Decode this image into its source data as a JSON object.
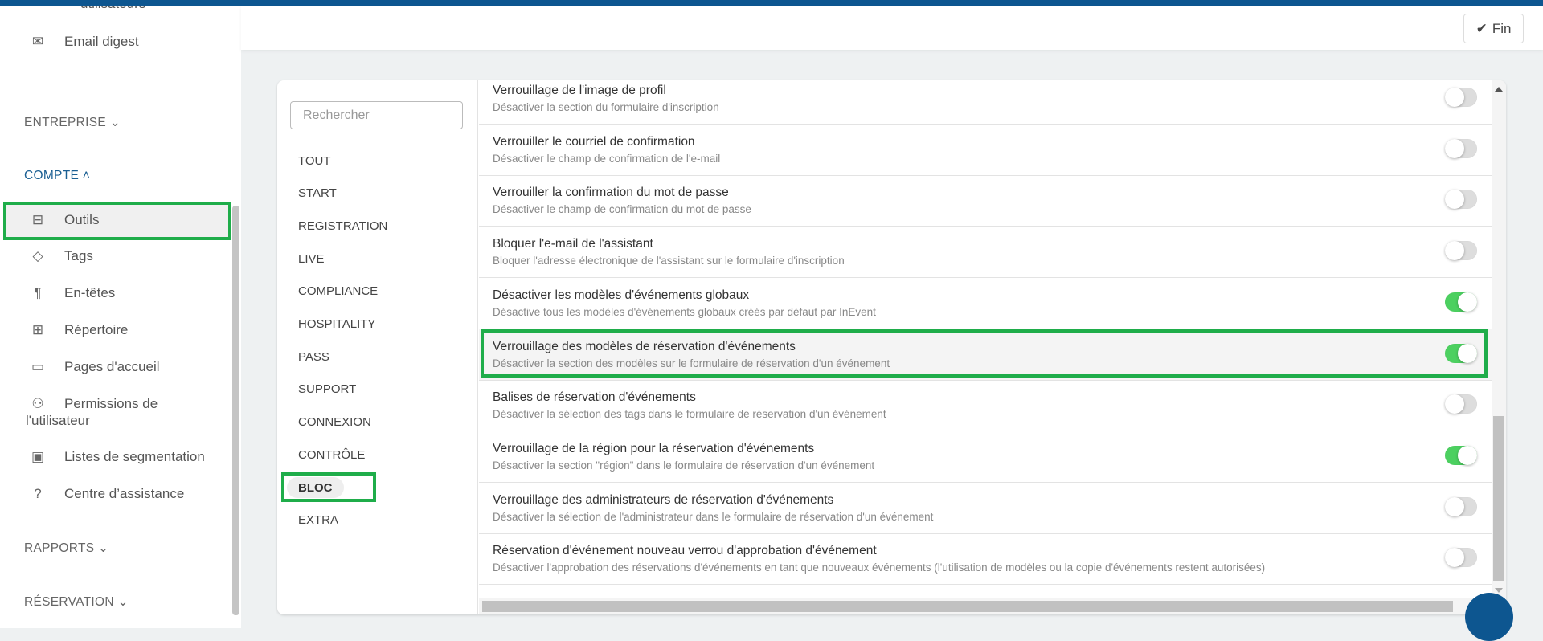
{
  "header": {
    "done_label": "Fin"
  },
  "sidebar": {
    "clipped_item": "utilisateurs",
    "email_digest": "Email digest",
    "sections": {
      "entreprise": "ENTREPRISE",
      "compte": "COMPTE",
      "rapports": "RAPPORTS",
      "reservation": "RÉSERVATION"
    },
    "items": [
      {
        "label": "Outils",
        "icon": "toolbox-icon",
        "selected": true
      },
      {
        "label": "Tags",
        "icon": "tag-icon"
      },
      {
        "label": "En-têtes",
        "icon": "pilcrow-icon"
      },
      {
        "label": "Répertoire",
        "icon": "sitemap-icon"
      },
      {
        "label": "Pages d'accueil",
        "icon": "window-icon"
      },
      {
        "label": "Permissions de",
        "label2": "l'utilisateur",
        "icon": "users-lock-icon"
      },
      {
        "label": "Listes de segmentation",
        "icon": "contact-book-icon"
      },
      {
        "label": "Centre d’assistance",
        "icon": "help-circle-icon"
      }
    ]
  },
  "filters": {
    "search_placeholder": "Rechercher",
    "items": [
      "TOUT",
      "START",
      "REGISTRATION",
      "LIVE",
      "COMPLIANCE",
      "HOSPITALITY",
      "PASS",
      "SUPPORT",
      "CONNEXION",
      "CONTRÔLE",
      "BLOC",
      "EXTRA"
    ],
    "selected": "BLOC"
  },
  "settings": [
    {
      "title": "Verrouillage de l'image de profil",
      "desc": "Désactiver la section du formulaire d'inscription",
      "on": false
    },
    {
      "title": "Verrouiller le courriel de confirmation",
      "desc": "Désactiver le champ de confirmation de l'e-mail",
      "on": false
    },
    {
      "title": "Verrouiller la confirmation du mot de passe",
      "desc": "Désactiver le champ de confirmation du mot de passe",
      "on": false
    },
    {
      "title": "Bloquer l'e-mail de l'assistant",
      "desc": "Bloquer l'adresse électronique de l'assistant sur le formulaire d'inscription",
      "on": false
    },
    {
      "title": "Désactiver les modèles d'événements globaux",
      "desc": "Désactive tous les modèles d'événements globaux créés par défaut par InEvent",
      "on": true
    },
    {
      "title": "Verrouillage des modèles de réservation d'événements",
      "desc": "Désactiver la section des modèles sur le formulaire de réservation d'un événement",
      "on": true,
      "highlighted": true
    },
    {
      "title": "Balises de réservation d'événements",
      "desc": "Désactiver la sélection des tags dans le formulaire de réservation d'un événement",
      "on": false
    },
    {
      "title": "Verrouillage de la région pour la réservation d'événements",
      "desc": "Désactiver la section \"région\" dans le formulaire de réservation d'un événement",
      "on": true
    },
    {
      "title": "Verrouillage des administrateurs de réservation d'événements",
      "desc": "Désactiver la sélection de l'administrateur dans le formulaire de réservation d'un événement",
      "on": false
    },
    {
      "title": "Réservation d'événement nouveau verrou d'approbation d'événement",
      "desc": "Désactiver l'approbation des réservations d'événements en tant que nouveaux événements (l'utilisation de modèles ou la copie d'événements restent autorisées)",
      "on": false
    }
  ],
  "colors": {
    "brand": "#0d5690",
    "toggle_on": "#4cd060",
    "highlight": "#1fad4a"
  }
}
